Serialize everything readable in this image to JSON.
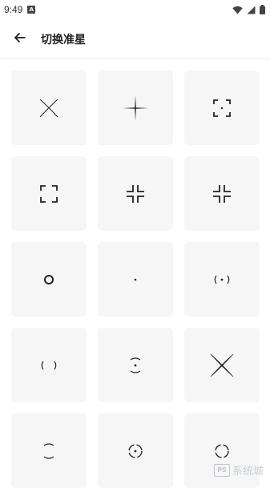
{
  "status_bar": {
    "time": "9:49",
    "app_icon_letter": "A",
    "icons": [
      "wifi-icon",
      "signal-icon",
      "battery-icon"
    ]
  },
  "app_bar": {
    "back_icon": "arrow-left-icon",
    "title": "切换准星"
  },
  "crosshairs": [
    "crosshair-x",
    "crosshair-plus",
    "crosshair-dotted-bracket",
    "crosshair-corner-brackets",
    "crosshair-inward-corners",
    "crosshair-inward-corners-alt",
    "crosshair-circle",
    "crosshair-dot",
    "crosshair-paren-dot",
    "crosshair-parens",
    "crosshair-arc-dot",
    "crosshair-x-large",
    "crosshair-arc-small",
    "crosshair-circle-dot",
    "crosshair-circle-partial"
  ],
  "watermark": {
    "logo_text": "PS",
    "text": "系统城"
  },
  "colors": {
    "cell_background": "#f6f6f6",
    "icon_stroke": "#222222",
    "divider": "#ececec"
  }
}
